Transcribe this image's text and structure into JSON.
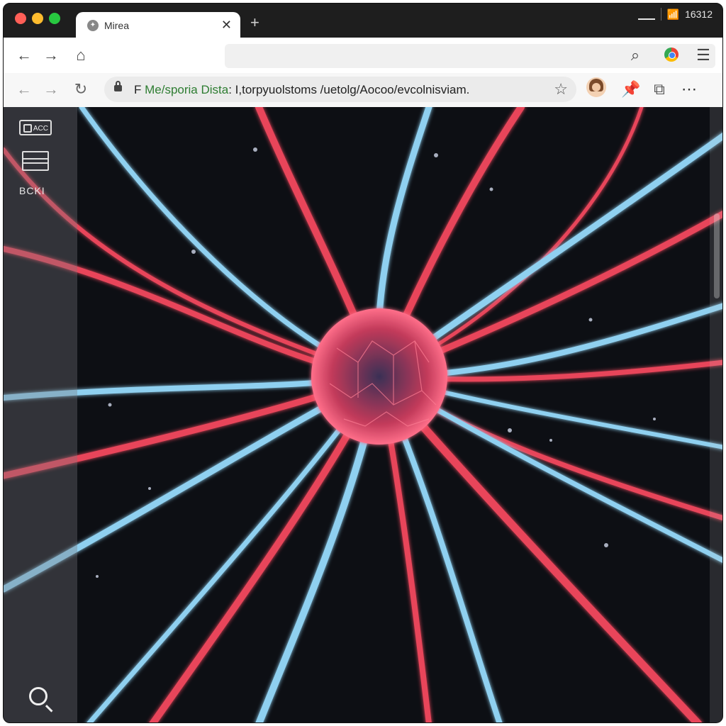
{
  "window": {
    "tab": {
      "title": "Mirea"
    },
    "status": {
      "time": "16312"
    }
  },
  "toolbar": {
    "icons": [
      "back-icon",
      "forward-icon",
      "home-icon",
      "search-icon",
      "chrome-logo-icon",
      "menu-icon"
    ]
  },
  "address_bar": {
    "prefix": "F",
    "site_part": "Me/sporia Dista",
    "path_part": ": I,torpyuolstoms /uetolg/Aocoo/evcolnisviam."
  },
  "sidebar": {
    "item1_label": "ACC",
    "label": "BCKI"
  },
  "content": {
    "description_icon": "neuron-illustration",
    "colors": {
      "red": "#e8445a",
      "blue": "#8fd0f0",
      "background": "#0d0f14"
    }
  }
}
